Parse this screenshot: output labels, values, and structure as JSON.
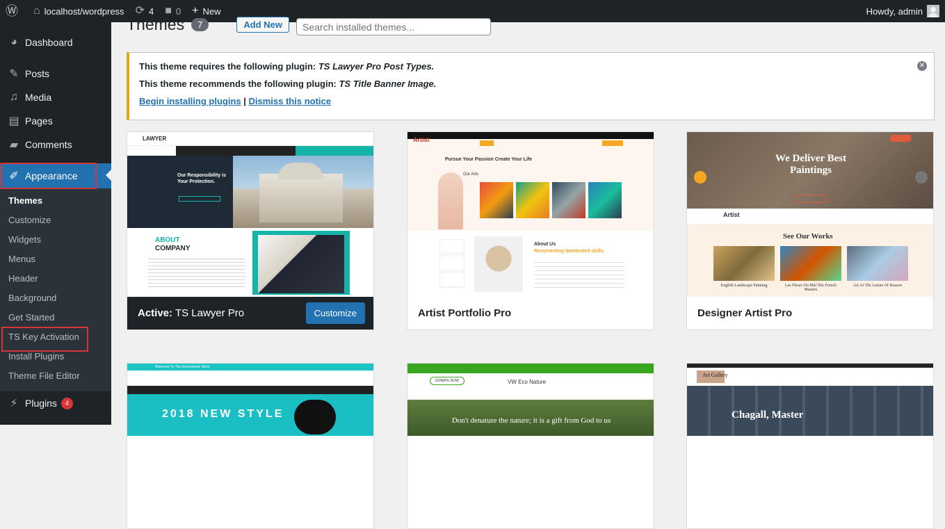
{
  "adminbar": {
    "site": "localhost/wordpress",
    "updates": "4",
    "comments": "0",
    "new": "New",
    "howdy": "Howdy, admin"
  },
  "sidebar": {
    "items": [
      {
        "label": "Dashboard",
        "icon": "dashboard-icon"
      },
      {
        "label": "Posts",
        "icon": "pin-icon"
      },
      {
        "label": "Media",
        "icon": "media-icon"
      },
      {
        "label": "Pages",
        "icon": "pages-icon"
      },
      {
        "label": "Comments",
        "icon": "comment-icon"
      },
      {
        "label": "Appearance",
        "icon": "brush-icon"
      }
    ],
    "submenu": [
      "Themes",
      "Customize",
      "Widgets",
      "Menus",
      "Header",
      "Background",
      "Get Started",
      "TS Key Activation",
      "Install Plugins",
      "Theme File Editor"
    ],
    "plugins": {
      "label": "Plugins",
      "badge": "4"
    }
  },
  "header": {
    "title": "Themes",
    "count": "7",
    "add_new": "Add New",
    "search_placeholder": "Search installed themes..."
  },
  "notice": {
    "line1_prefix": "This theme requires the following plugin: ",
    "line1_plugin": "TS Lawyer Pro Post Types.",
    "line2_prefix": "This theme recommends the following plugin: ",
    "line2_plugin": "TS Title Banner Image.",
    "begin": "Begin installing plugins",
    "sep": " | ",
    "dismiss": "Dismiss this notice"
  },
  "themes": [
    {
      "name": "TS Lawyer Pro",
      "active_label": "Active:",
      "customize": "Customize",
      "shot": {
        "heading": "Our Responsibility is Your Protection.",
        "about": "ABOUT",
        "company": "COMPANY",
        "brand": "LAWYER"
      }
    },
    {
      "name": "Artist Portfolio Pro",
      "shot": {
        "tagline": "Pursue Your Passion Create Your Life",
        "section": "Our Arts",
        "about": "About Us",
        "sub": "Resurrecting timetested skills.",
        "brand": "Artist"
      }
    },
    {
      "name": "Designer Artist Pro",
      "shot": {
        "hero": "We Deliver Best Paintings",
        "works": "See Our Works",
        "items": [
          "English Landscape Painting",
          "Les Fleurs Du Mal The French Masters",
          "Art At The Limits Of Reason"
        ],
        "brand": "Artist"
      }
    },
    {
      "name": "",
      "shot": {
        "text": "2018 NEW STYLE",
        "top": "Welcome To The Ecommerce Store"
      }
    },
    {
      "name": "",
      "shot": {
        "brand": "VW Eco Nature",
        "quote": "Don't denature the nature; it is a gift from God to us",
        "donate": "DONATE NOW"
      }
    },
    {
      "name": "",
      "shot": {
        "brand": "Art Gallery",
        "hero": "Chagall, Master"
      }
    }
  ]
}
